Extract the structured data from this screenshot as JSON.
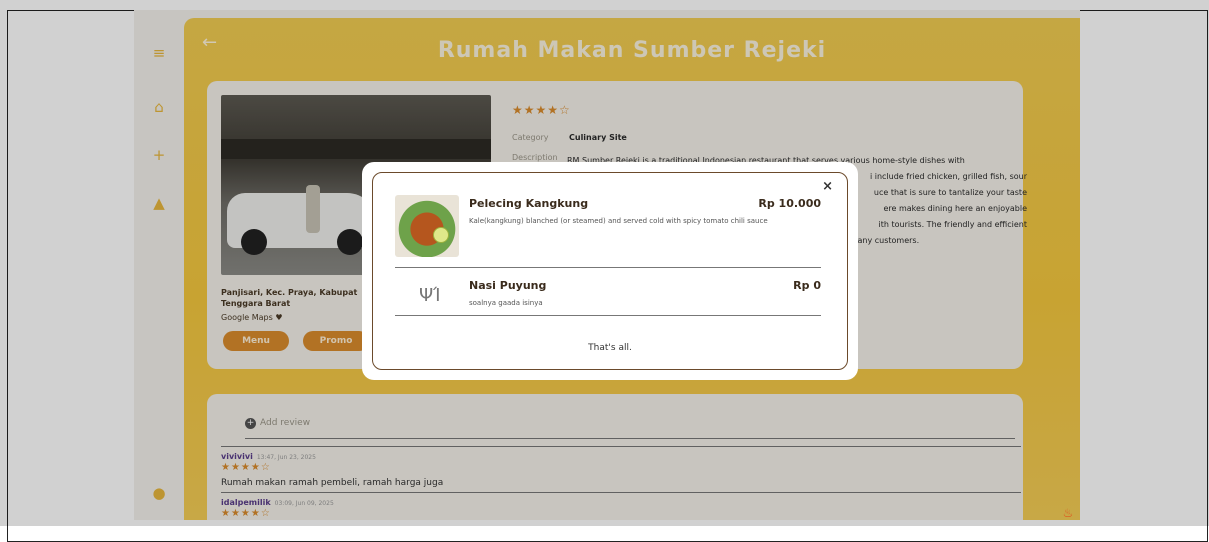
{
  "page": {
    "title": "Rumah Makan Sumber Rejeki",
    "back_icon": "arrow-left-icon"
  },
  "sidebar": {
    "icons": [
      "menu-icon",
      "home-icon",
      "plus-icon",
      "bell-icon",
      "user-icon"
    ]
  },
  "restaurant": {
    "rating_stars": "★★★★☆",
    "category_label": "Category",
    "category_value": "Culinary Site",
    "description_label": "Description",
    "description_visible": "RM Sumber Rejeki is a traditional Indonesian restaurant that serves various home-style dishes with",
    "description_line2": "i include fried chicken, grilled fish, sour",
    "description_line3": "uce that is sure to tantalize your taste",
    "description_line4": "ere makes dining here an enjoyable",
    "description_line5": "ith tourists. The friendly and efficient",
    "description_line6": "ng many customers.",
    "address_line1": "Panjisari, Kec. Praya, Kabupat",
    "address_line2": "Tenggara Barat",
    "google_maps": "Google Maps",
    "menu_button": "Menu",
    "promo_button": "Promo"
  },
  "reviews": {
    "add_review": "Add review",
    "items": [
      {
        "user": "vivivivi",
        "time": "13:47, Jun 23, 2025",
        "stars": "★★★★☆",
        "text": "Rumah makan ramah pembeli, ramah harga juga"
      },
      {
        "user": "idalpemilik",
        "time": "03:09, Jun 09, 2025",
        "stars": "★★★★☆",
        "text": ""
      }
    ]
  },
  "menu_modal": {
    "close": "×",
    "items": [
      {
        "name": "Pelecing Kangkung",
        "price": "Rp 10.000",
        "description": "Kale(kangkung) blanched (or steamed) and served cold with spicy tomato chili sauce"
      },
      {
        "name": "Nasi Puyung",
        "price": "Rp 0",
        "description": "soalnya gaada isinya"
      }
    ],
    "footer": "That's all."
  },
  "colors": {
    "accent": "#d98b2c",
    "banner": "#f4c73e"
  }
}
